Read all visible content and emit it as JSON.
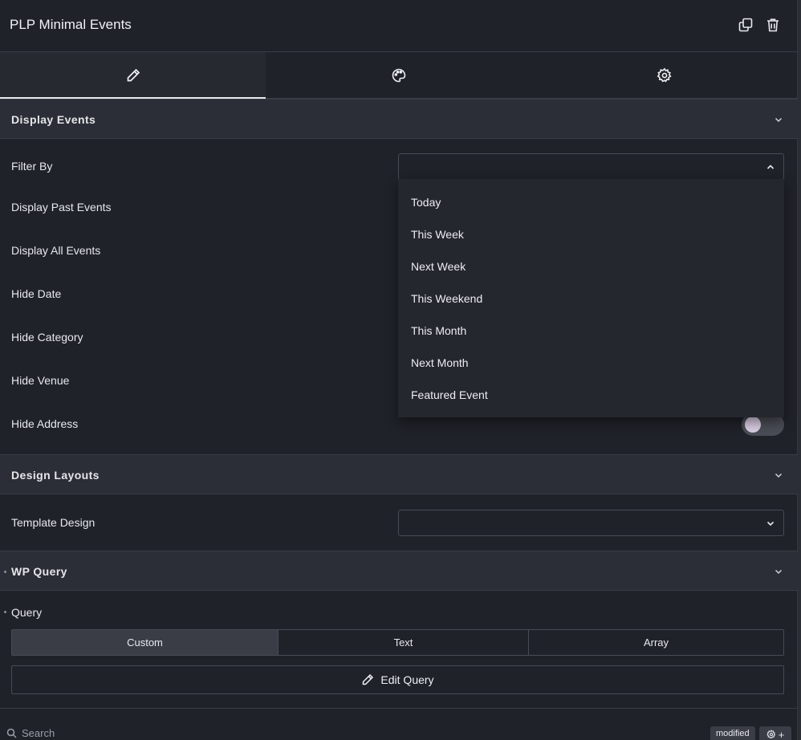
{
  "header": {
    "title": "PLP Minimal Events"
  },
  "tabs": [
    {
      "icon": "pencil-icon",
      "active": true
    },
    {
      "icon": "palette-icon",
      "active": false
    },
    {
      "icon": "gear-icon",
      "active": false
    }
  ],
  "sections": {
    "display_events": {
      "label": "Display Events"
    },
    "design_layouts": {
      "label": "Design Layouts"
    },
    "wp_query": {
      "label": "WP Query"
    }
  },
  "fields": {
    "filter_by": "Filter By",
    "display_past_events": "Display Past Events",
    "display_all_events": "Display All Events",
    "hide_date": "Hide Date",
    "hide_category": "Hide Category",
    "hide_venue": "Hide Venue",
    "hide_address": "Hide Address",
    "template_design": "Template Design",
    "query": "Query"
  },
  "filter_dropdown": {
    "options": [
      "Today",
      "This Week",
      "Next Week",
      "This Weekend",
      "This Month",
      "Next Month",
      "Featured Event"
    ]
  },
  "query_modes": [
    "Custom",
    "Text",
    "Array"
  ],
  "edit_query_label": "Edit Query",
  "footer": {
    "search_placeholder": "Search",
    "modified_badge": "modified",
    "add_label": "+"
  },
  "colors": {
    "background": "#1f2229",
    "section_header": "#2b2e36",
    "border": "#474b54",
    "toggle_knob": "#d9cde3"
  }
}
